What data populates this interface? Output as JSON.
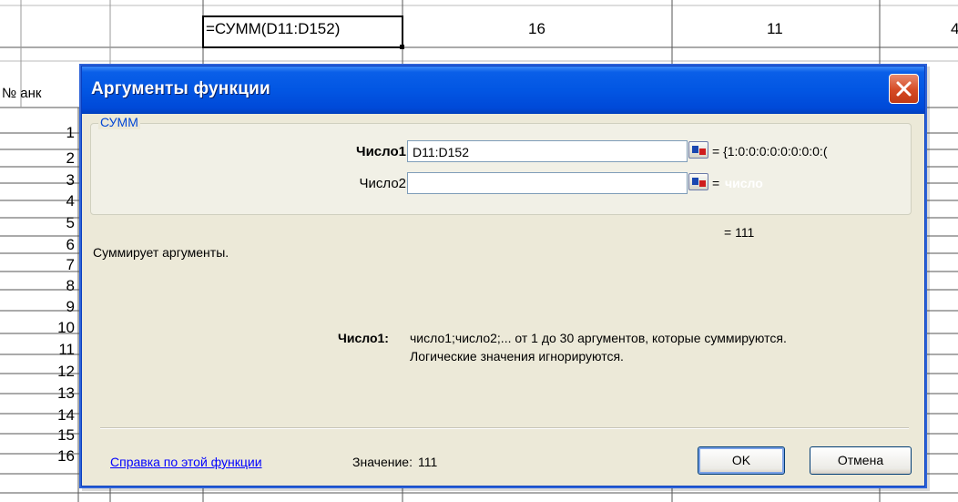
{
  "spreadsheet": {
    "formula_cell": "=СУММ(D11:D152)",
    "cell_e": "16",
    "cell_f": "11",
    "cell_g": "4",
    "header_left": "№ анк",
    "row_numbers": [
      "1",
      "2",
      "3",
      "4",
      "5",
      "6",
      "7",
      "8",
      "9",
      "10",
      "11",
      "12",
      "13",
      "14",
      "15",
      "16"
    ]
  },
  "dialog": {
    "title": "Аргументы функции",
    "group_label": "СУММ",
    "arg1_label": "Число1",
    "arg1_value": "D11:D152",
    "arg1_result": "= {1:0:0:0:0:0:0:0:0:(",
    "arg2_label": "Число2",
    "arg2_value": "",
    "arg2_result_eq": "=",
    "arg2_result_placeholder": "число",
    "total_result": "= 111",
    "description": "Суммирует аргументы.",
    "arg_help_label": "Число1:",
    "arg_help_line1": "число1;число2;... от 1 до 30 аргументов, которые суммируются.",
    "arg_help_line2": "Логические значения игнорируются.",
    "help_link": "Справка по этой функции",
    "value_label": "Значение:",
    "value": "111",
    "ok_label": "OK",
    "cancel_label": "Отмена"
  },
  "colors": {
    "titlebar": "#0256e3",
    "dialog_bg": "#ece9d8",
    "close_button": "#d54a24",
    "link": "#0000ff"
  }
}
